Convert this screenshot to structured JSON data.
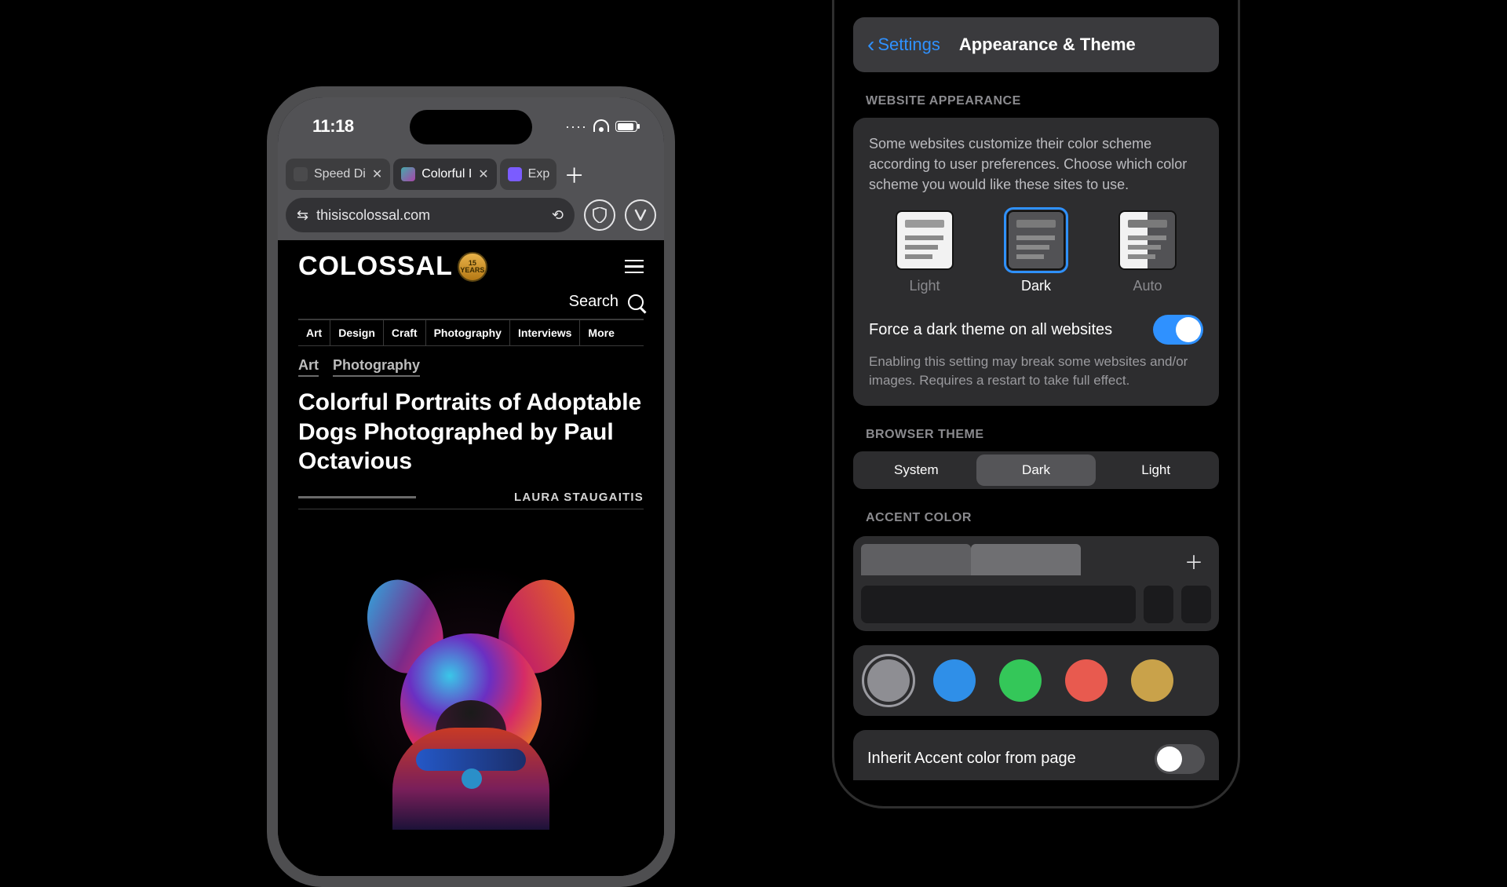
{
  "left_phone": {
    "status": {
      "time": "11:18"
    },
    "tabs": [
      {
        "label": "Speed Di",
        "active": false
      },
      {
        "label": "Colorful I",
        "active": true
      },
      {
        "label": "Exp",
        "active": false
      }
    ],
    "address": "thisiscolossal.com",
    "site": {
      "logo_text": "COLOSSAL",
      "badge_text": "15 YEARS",
      "search_label": "Search",
      "nav": [
        "Art",
        "Design",
        "Craft",
        "Photography",
        "Interviews",
        "More"
      ],
      "crumbs": [
        "Art",
        "Photography"
      ],
      "headline": "Colorful Portraits of Adoptable Dogs Photographed by Paul Octavious",
      "byline": "LAURA STAUGAITIS"
    }
  },
  "right_phone": {
    "back_label": "Settings",
    "title": "Appearance & Theme",
    "website_appearance": {
      "section": "WEBSITE APPEARANCE",
      "desc": "Some websites customize their color scheme according to user preferences. Choose which color scheme you would like these sites to use.",
      "options": {
        "light": "Light",
        "dark": "Dark",
        "auto": "Auto"
      },
      "selected": "Dark",
      "force_dark_label": "Force a dark theme on all websites",
      "force_dark_on": true,
      "force_dark_desc": "Enabling this setting may break some websites and/or images. Requires a restart to take full effect."
    },
    "browser_theme": {
      "section": "BROWSER THEME",
      "options": [
        "System",
        "Dark",
        "Light"
      ],
      "selected": "Dark"
    },
    "accent": {
      "section": "ACCENT COLOR",
      "colors": [
        "#8e8e93",
        "#2f8fe8",
        "#34c759",
        "#e85a4f",
        "#c9a24a"
      ],
      "selected_index": 0,
      "inherit_label": "Inherit Accent color from page",
      "inherit_on": false
    }
  }
}
